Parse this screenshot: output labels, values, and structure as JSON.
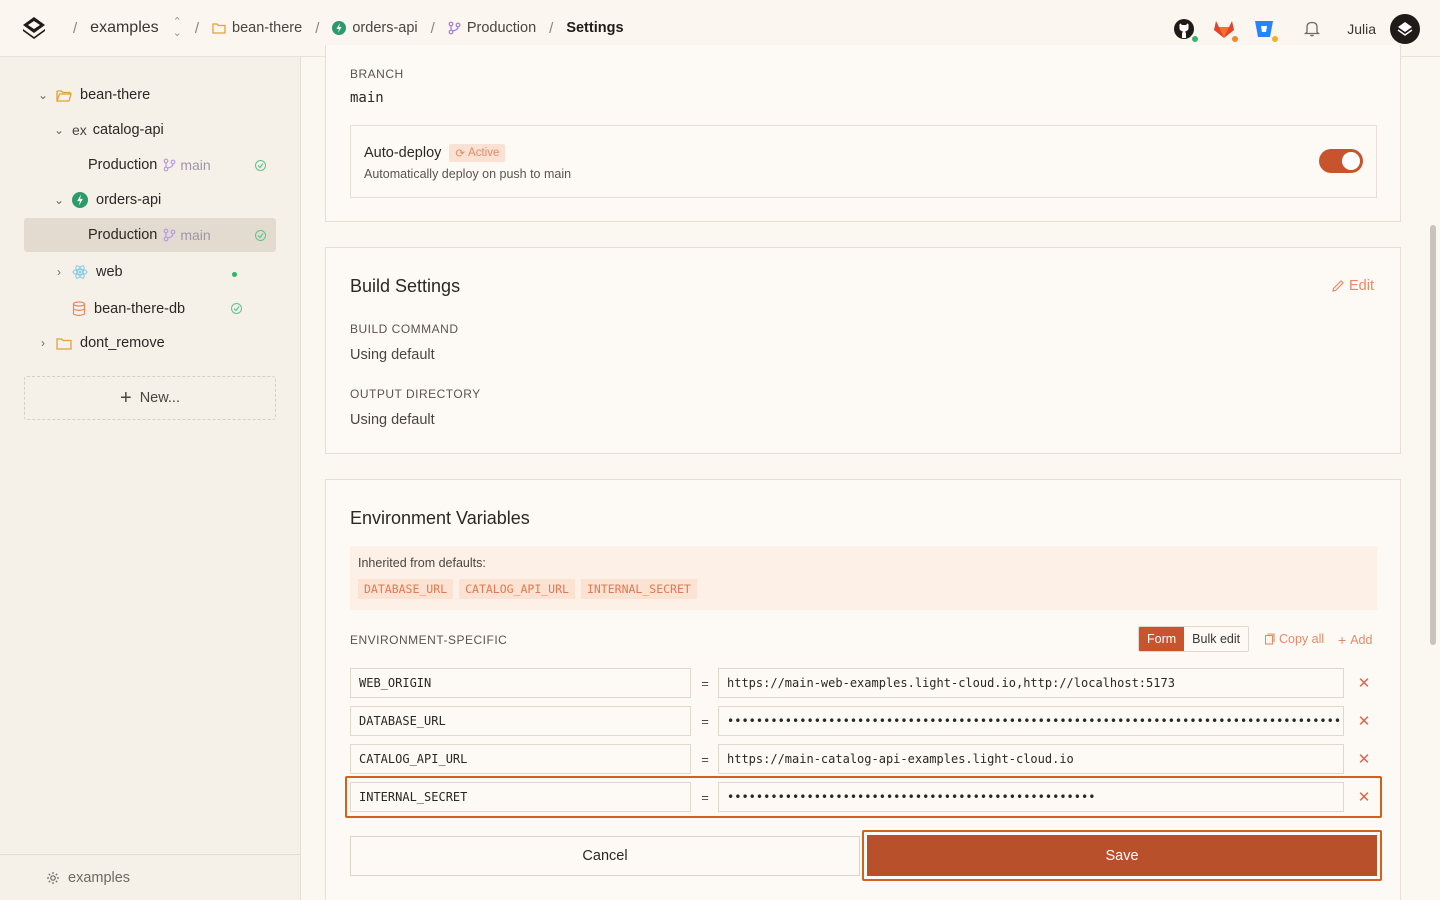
{
  "breadcrumb": {
    "team": "examples",
    "project": "bean-there",
    "service": "orders-api",
    "environment": "Production",
    "page": "Settings",
    "separator": "/"
  },
  "header": {
    "user_name": "Julia"
  },
  "sidebar": {
    "tree": [
      {
        "label": "bean-there"
      },
      {
        "label": "catalog-api",
        "prefix": "ex"
      },
      {
        "label": "Production",
        "branch": "main"
      },
      {
        "label": "orders-api"
      },
      {
        "label": "Production",
        "branch": "main"
      },
      {
        "label": "web"
      },
      {
        "label": "bean-there-db"
      },
      {
        "label": "dont_remove"
      }
    ],
    "new_label": "New...",
    "footer_label": "examples"
  },
  "branch_card": {
    "branch_label": "BRANCH",
    "branch_value": "main",
    "autodeploy_title": "Auto-deploy",
    "autodeploy_badge": "Active",
    "autodeploy_desc": "Automatically deploy on push to main",
    "autodeploy_enabled": true
  },
  "build": {
    "title": "Build Settings",
    "edit_label": "Edit",
    "command_label": "BUILD COMMAND",
    "command_value": "Using default",
    "output_label": "OUTPUT DIRECTORY",
    "output_value": "Using default"
  },
  "env": {
    "title": "Environment Variables",
    "inherited_label": "Inherited from defaults:",
    "inherited": [
      "DATABASE_URL",
      "CATALOG_API_URL",
      "INTERNAL_SECRET"
    ],
    "specific_label": "ENVIRONMENT-SPECIFIC",
    "mode_form": "Form",
    "mode_bulk": "Bulk edit",
    "copy_all": "Copy all",
    "add": "Add",
    "equals": "=",
    "vars": [
      {
        "key": "WEB_ORIGIN",
        "value": "https://main-web-examples.light-cloud.io,http://localhost:5173"
      },
      {
        "key": "DATABASE_URL",
        "value": "••••••••••••••••••••••••••••••••••••••••••••••••••••••••••••••••••••••••••••••••••••••••••••"
      },
      {
        "key": "CATALOG_API_URL",
        "value": "https://main-catalog-api-examples.light-cloud.io"
      },
      {
        "key": "INTERNAL_SECRET",
        "value": "•••••••••••••••••••••••••••••••••••••••••••••••••••"
      }
    ],
    "cancel_label": "Cancel",
    "save_label": "Save"
  },
  "colors": {
    "accent": "#c8542d",
    "success": "#5cc58b",
    "branch": "#9e97a8"
  }
}
